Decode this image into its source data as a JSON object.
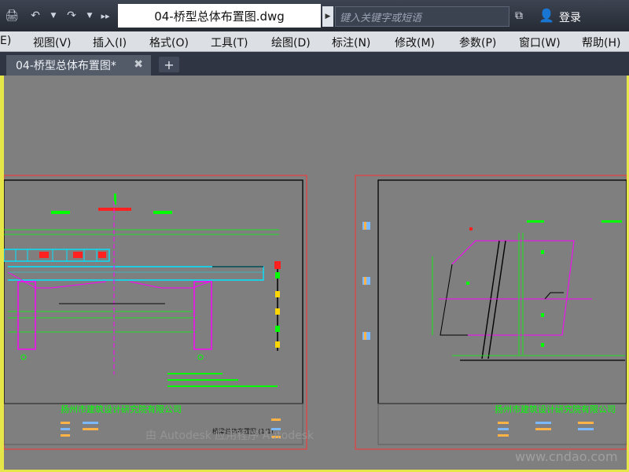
{
  "titlebar": {
    "doc_title": "04-桥型总体布置图.dwg",
    "search_placeholder": "键入关键字或短语",
    "login_label": "登录"
  },
  "menu": [
    "E)",
    "视图(V)",
    "插入(I)",
    "格式(O)",
    "工具(T)",
    "绘图(D)",
    "标注(N)",
    "修改(M)",
    "参数(P)",
    "窗口(W)",
    "帮助(H)"
  ],
  "tabs": [
    {
      "label": "04-桥型总体布置图*"
    }
  ],
  "drawing": {
    "left_company": "扬州市建筑设计研究院有限公司",
    "right_company": "扬州市建筑设计研究院有限公司",
    "drawing_title": "桥梁总体布置图 (1/1)",
    "watermark_overlay": "由 Autodesk 应用程序 Autodesk",
    "watermark_site": "www.cndao.com"
  },
  "colors": {
    "titlebar": "#2c323c",
    "canvas": "#7f7f7f",
    "frame": "#e6e54a",
    "cyan": "#00e5ff",
    "magenta": "#ff00ff",
    "green": "#00ff00",
    "red": "#ff2020"
  }
}
